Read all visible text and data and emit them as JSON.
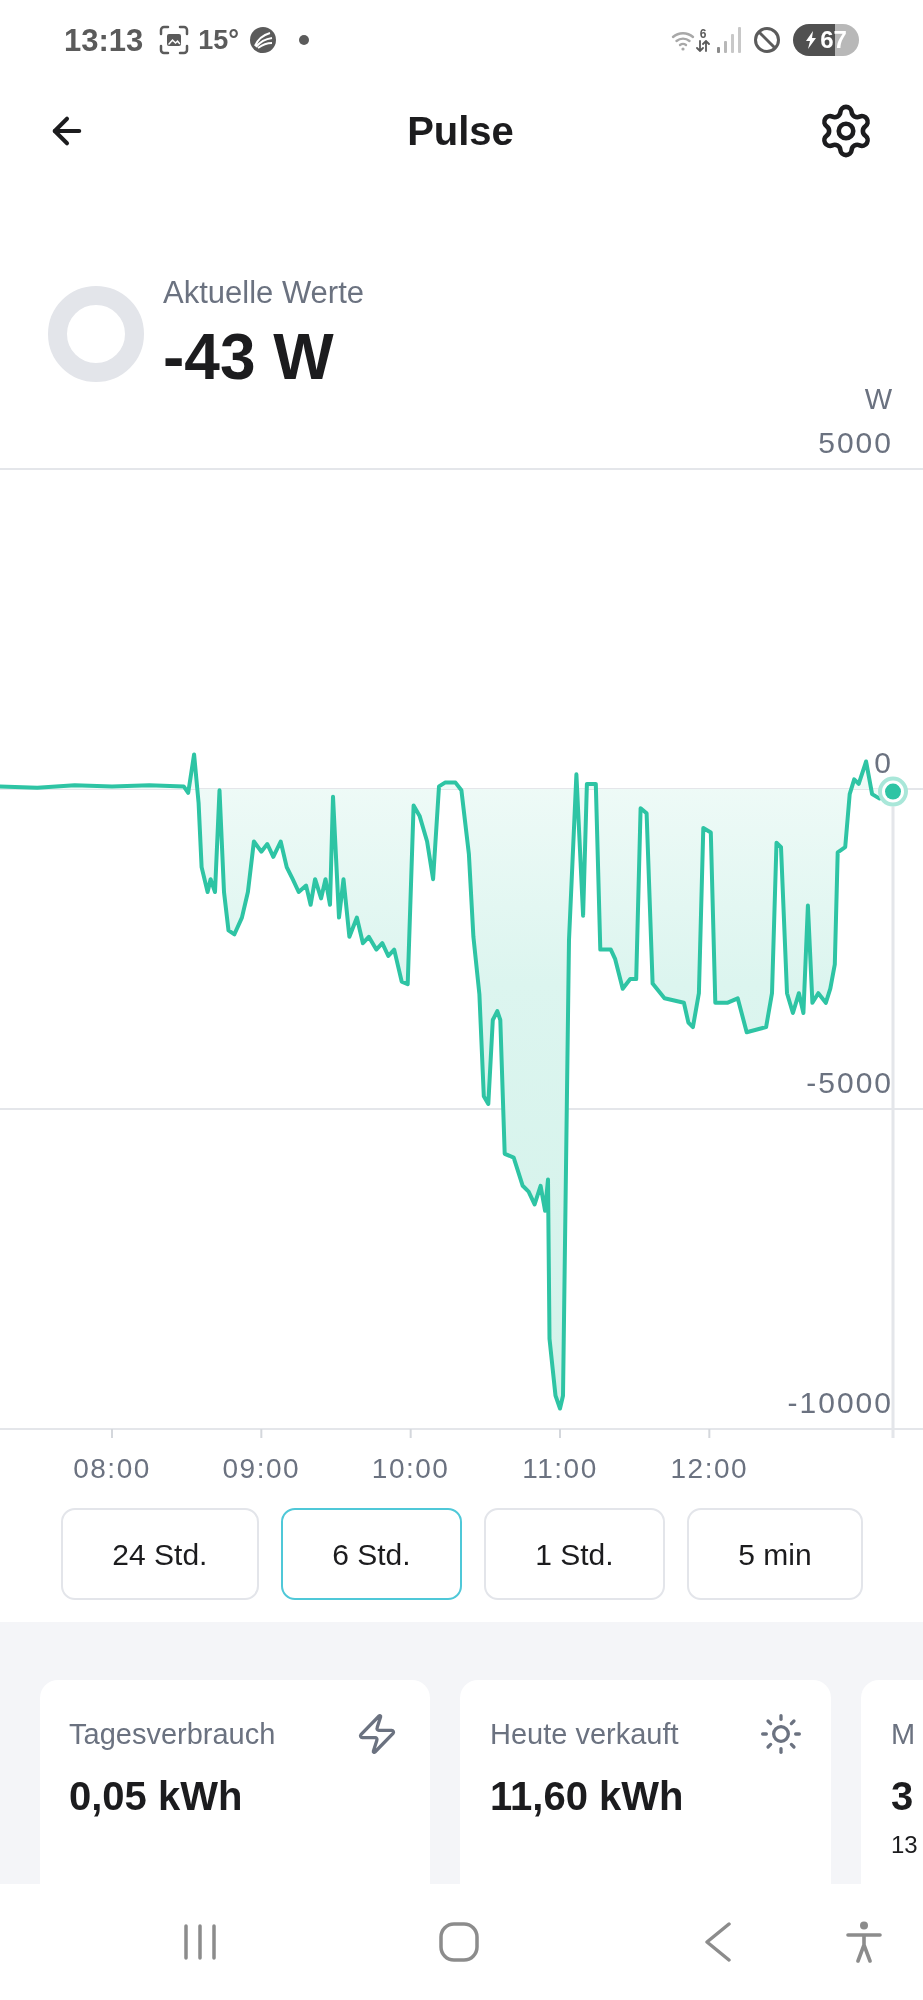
{
  "status_bar": {
    "time": "13:13",
    "temperature": "15°",
    "network_type": "6",
    "battery": "67"
  },
  "header": {
    "title": "Pulse"
  },
  "current": {
    "label": "Aktuelle Werte",
    "value": "-43 W"
  },
  "chart": {
    "chart_data": {
      "type": "area",
      "ylabel": "W",
      "x": [
        7.25,
        7.5,
        7.75,
        8,
        8.25,
        8.48,
        8.51,
        8.55,
        8.58,
        8.6,
        8.64,
        8.66,
        8.69,
        8.72,
        8.75,
        8.78,
        8.82,
        8.87,
        8.91,
        8.95,
        9,
        9.04,
        9.08,
        9.13,
        9.17,
        9.21,
        9.25,
        9.3,
        9.33,
        9.36,
        9.4,
        9.43,
        9.46,
        9.48,
        9.52,
        9.55,
        9.59,
        9.64,
        9.68,
        9.72,
        9.77,
        9.81,
        9.85,
        9.89,
        9.94,
        9.98,
        10.02,
        10.06,
        10.11,
        10.15,
        10.19,
        10.23,
        10.3,
        10.34,
        10.39,
        10.42,
        10.46,
        10.49,
        10.52,
        10.55,
        10.58,
        10.6,
        10.63,
        10.69,
        10.75,
        10.79,
        10.83,
        10.87,
        10.9,
        10.92,
        10.93,
        10.97,
        11,
        11.02,
        11.06,
        11.11,
        11.155,
        11.18,
        11.24,
        11.27,
        11.34,
        11.37,
        11.42,
        11.47,
        11.51,
        11.54,
        11.58,
        11.62,
        11.7,
        11.83,
        11.86,
        11.89,
        11.93,
        11.96,
        12.01,
        12.04,
        12.12,
        12.19,
        12.25,
        12.38,
        12.42,
        12.45,
        12.48,
        12.52,
        12.56,
        12.6,
        12.63,
        12.66,
        12.69,
        12.73,
        12.78,
        12.81,
        12.84,
        12.86,
        12.91,
        12.94,
        12.97,
        13,
        13.05,
        13.09,
        13.14,
        13.23
      ],
      "series": [
        {
          "color": "#2ec4a4",
          "values": [
            40,
            20,
            60,
            40,
            60,
            40,
            -60,
            540,
            -220,
            -1220,
            -1610,
            -1410,
            -1610,
            -20,
            -1610,
            -2210,
            -2270,
            -2010,
            -1610,
            -820,
            -980,
            -860,
            -1060,
            -820,
            -1220,
            -1410,
            -1610,
            -1510,
            -1810,
            -1410,
            -1710,
            -1410,
            -1810,
            -120,
            -2010,
            -1410,
            -2310,
            -2010,
            -2410,
            -2310,
            -2510,
            -2410,
            -2610,
            -2510,
            -3010,
            -3050,
            -260,
            -420,
            -820,
            -1410,
            40,
            100,
            100,
            -20,
            -1020,
            -2310,
            -3210,
            -4800,
            -4920,
            -3610,
            -3470,
            -3610,
            -5700,
            -5760,
            -6200,
            -6290,
            -6490,
            -6200,
            -6590,
            -6100,
            -8590,
            -9480,
            -9680,
            -9480,
            -2360,
            230,
            -1980,
            80,
            80,
            -2510,
            -2510,
            -2660,
            -3120,
            -2970,
            -2970,
            -300,
            -380,
            -3040,
            -3270,
            -3340,
            -3650,
            -3720,
            -3190,
            -610,
            -680,
            -3340,
            -3340,
            -3270,
            -3800,
            -3720,
            -3190,
            -840,
            -910,
            -3190,
            -3500,
            -3190,
            -3500,
            -1820,
            -3340,
            -3190,
            -3340,
            -3120,
            -2740,
            -990,
            -910,
            -80,
            150,
            80,
            430,
            -80,
            -150,
            -40
          ]
        }
      ],
      "xlim": [
        7.25,
        13.23
      ],
      "ylim": [
        -10000,
        5000
      ],
      "yticks": [
        5000,
        0,
        -5000,
        -10000
      ],
      "xticks": [
        {
          "value": 8,
          "label": "08:00"
        },
        {
          "value": 9,
          "label": "09:00"
        },
        {
          "value": 10,
          "label": "10:00"
        },
        {
          "value": 11,
          "label": "11:00"
        },
        {
          "value": 12,
          "label": "12:00"
        }
      ]
    }
  },
  "ranges": [
    {
      "label": "24 Std.",
      "selected": false
    },
    {
      "label": "6 Std.",
      "selected": true
    },
    {
      "label": "1 Std.",
      "selected": false
    },
    {
      "label": "5 min",
      "selected": false
    }
  ],
  "cards": [
    {
      "label": "Tagesverbrauch",
      "value": "0,05 kWh"
    },
    {
      "label": "Heute verkauft",
      "value": "11,60 kWh"
    },
    {
      "label": "M",
      "value": "3",
      "note": "13"
    }
  ]
}
